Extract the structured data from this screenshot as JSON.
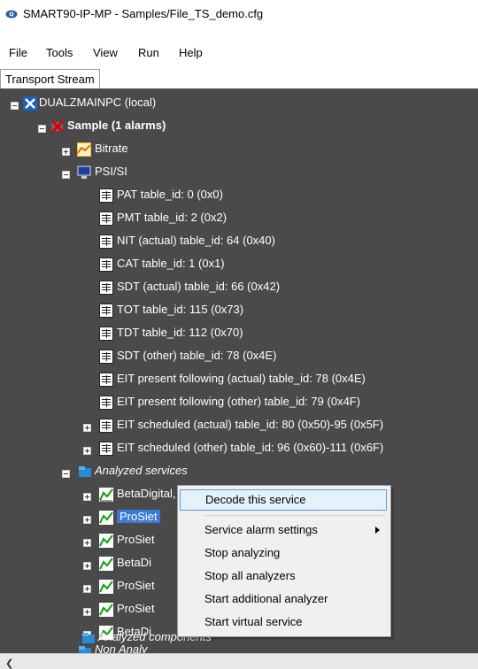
{
  "window": {
    "title": "SMART90-IP-MP - Samples/File_TS_demo.cfg"
  },
  "menu": [
    "File",
    "Tools",
    "View",
    "Run",
    "Help"
  ],
  "tab": {
    "label": "Transport Stream"
  },
  "tree": {
    "root": "DUALZMAINPC (local)",
    "sample": "Sample  (1 alarms)",
    "bitrate": "Bitrate",
    "psisi": "PSI/SI",
    "tables": [
      "PAT table_id: 0 (0x0)",
      "PMT table_id: 2 (0x2)",
      "NIT (actual) table_id: 64 (0x40)",
      "CAT table_id: 1 (0x1)",
      "SDT (actual) table_id: 66 (0x42)",
      "TOT table_id: 115 (0x73)",
      "TDT table_id: 112 (0x70)",
      "SDT (other) table_id: 78 (0x4E)",
      "EIT present following (actual) table_id: 78 (0x4E)",
      "EIT present following (other) table_id: 79 (0x4F)",
      "EIT scheduled (actual) table_id: 80 (0x50)-95 (0x5F)",
      "EIT scheduled (other) table_id: 96 (0x60)-111 (0x6F)"
    ],
    "analyzed_services": "Analyzed services",
    "services": [
      "BetaDigital, Home Shopping Europe",
      "ProSiet",
      "ProSiet",
      "BetaDi",
      "ProSiet",
      "ProSiet",
      "BetaDi"
    ],
    "non_analyzed": "Non Analy",
    "analyzed_components": "Analyzed components"
  },
  "context_menu": {
    "items": [
      "Decode this service",
      "Service alarm settings",
      "Stop analyzing",
      "Stop all analyzers",
      "Start additional analyzer",
      "Start virtual service"
    ]
  },
  "colors": {
    "tree_bg": "#4a4a4a",
    "selection": "#3a7ad4",
    "menu_highlight": "#e5f1fb"
  }
}
